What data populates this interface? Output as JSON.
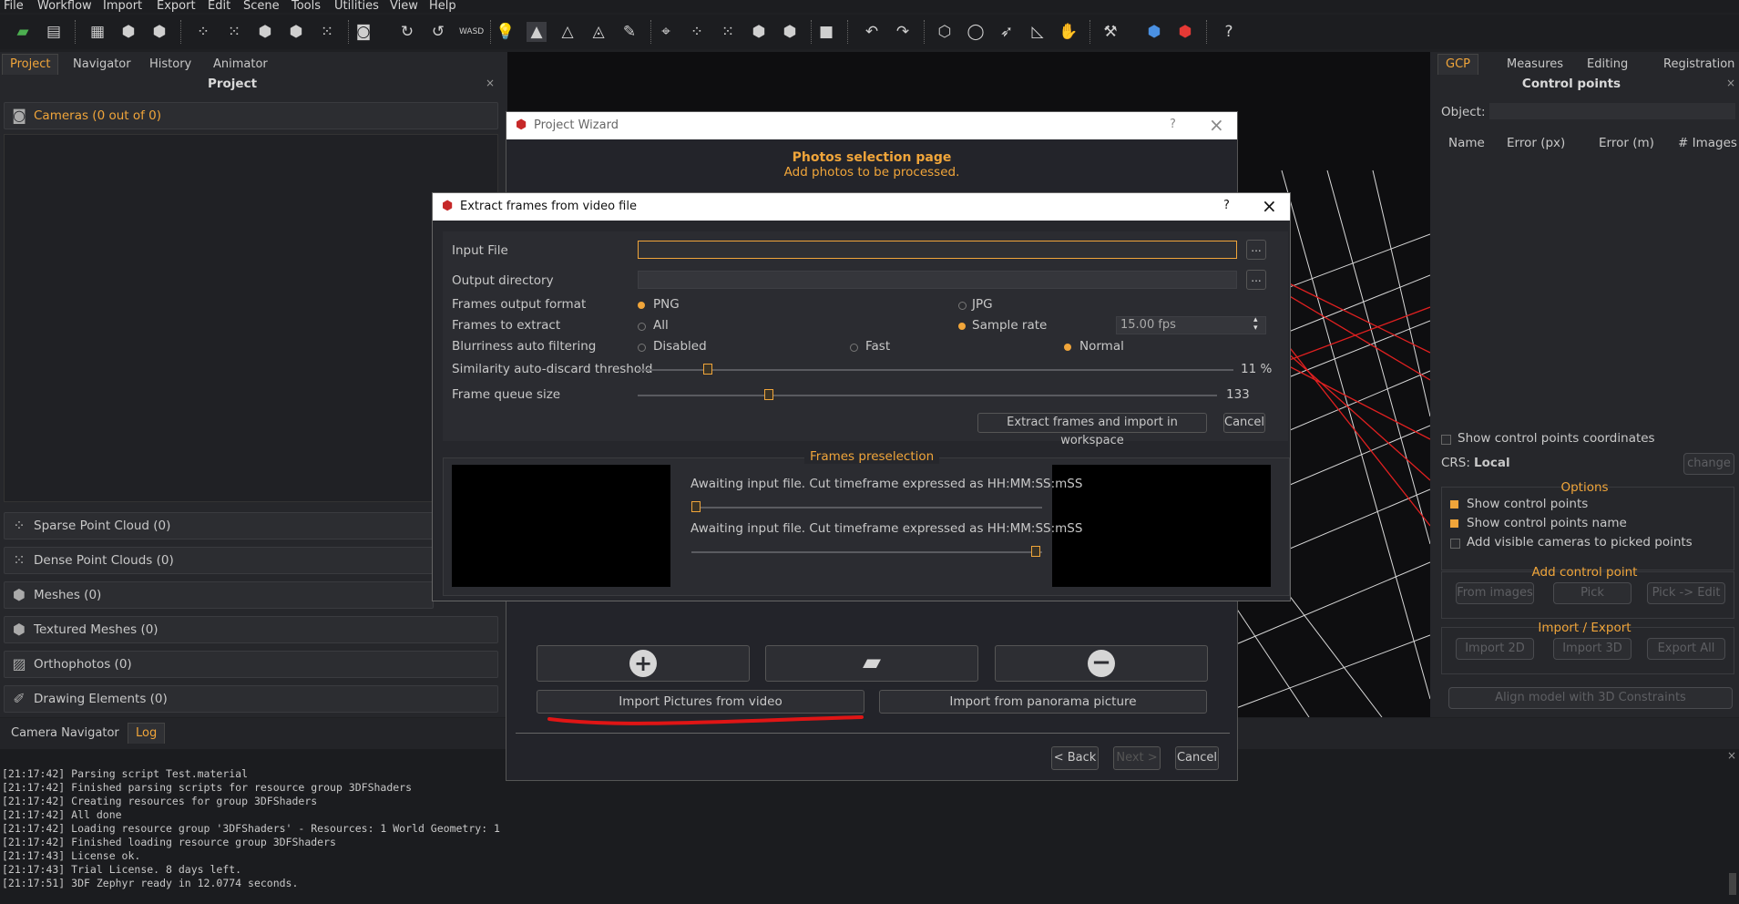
{
  "menubar": [
    "File",
    "Workflow",
    "Import",
    "Export",
    "Edit",
    "Scene",
    "Tools",
    "Utilities",
    "View",
    "Help"
  ],
  "toolbar_icons": [
    "folder-icon",
    "save-icon",
    "grid-icon",
    "cube-icon",
    "cube-icon",
    "points-icon",
    "points-icon",
    "cube-icon",
    "cube-icon",
    "points-icon",
    "camera-icon",
    "rotate-icon",
    "rotate-icon",
    "wasd-icon",
    "bulb-icon",
    "triangle-icon",
    "triangle-icon",
    "triangle-icon",
    "brush-icon",
    "measure-icon",
    "points-icon",
    "points-icon",
    "cube-icon",
    "cube-icon",
    "square-icon",
    "undo-icon",
    "redo-icon",
    "shape-icon",
    "circle-icon",
    "arrow-icon",
    "ruler-icon",
    "hand-icon",
    "tool-icon",
    "cube-blue-icon",
    "cube-red-icon",
    "help-icon"
  ],
  "left": {
    "tabs": [
      "Project",
      "Navigator",
      "History",
      "Animator"
    ],
    "title": "Project",
    "cameras": "Cameras (0 out of 0)",
    "sections": [
      "Sparse Point Cloud (0)",
      "Dense Point Clouds (0)",
      "Meshes (0)",
      "Textured Meshes (0)",
      "Orthophotos (0)",
      "Drawing Elements (0)"
    ]
  },
  "right": {
    "tabs": [
      "GCP",
      "Measures",
      "Editing",
      "Registration"
    ],
    "title": "Control points",
    "object_label": "Object:",
    "columns": [
      "Name",
      "Error (px)",
      "Error (m)",
      "# Images"
    ],
    "show_coords": "Show control points coordinates",
    "crs_label": "CRS:",
    "crs_value": "Local",
    "change": "change",
    "options_title": "Options",
    "options": [
      "Show control points",
      "Show control points name",
      "Add visible cameras to picked points"
    ],
    "add_title": "Add control point",
    "add_buttons": [
      "From images",
      "Pick",
      "Pick -> Edit"
    ],
    "io_title": "Import / Export",
    "io_buttons": [
      "Import 2D",
      "Import 3D",
      "Export All"
    ],
    "align": "Align model with 3D Constraints"
  },
  "bottom": {
    "tabs": [
      "Camera Navigator",
      "Log"
    ],
    "log": [
      "[21:17:42] Parsing script Test.material",
      "[21:17:42] Finished parsing scripts for resource group 3DFShaders",
      "[21:17:42] Creating resources for group 3DFShaders",
      "[21:17:42] All done",
      "[21:17:42] Loading resource group '3DFShaders' - Resources: 1 World Geometry: 1",
      "[21:17:42] Finished loading resource group 3DFShaders",
      "[21:17:43] License ok.",
      "[21:17:43] Trial License. 8 days left.",
      "[21:17:51] 3DF Zephyr ready in 12.0774 seconds."
    ]
  },
  "wizard": {
    "title": "Project Wizard",
    "help": "?",
    "page_title": "Photos selection page",
    "page_subtitle": "Add photos to be processed.",
    "import_video": "Import Pictures from video",
    "import_panorama": "Import from panorama picture",
    "back": "< Back",
    "next": "Next >",
    "cancel": "Cancel"
  },
  "extract": {
    "title": "Extract frames from video file",
    "help": "?",
    "input_file_label": "Input File",
    "input_file_value": "",
    "output_dir_label": "Output directory",
    "output_dir_value": "",
    "browse": "...",
    "format_label": "Frames output format",
    "format_png": "PNG",
    "format_jpg": "JPG",
    "frames_label": "Frames to extract",
    "frames_all": "All",
    "frames_sample": "Sample rate",
    "fps": "15.00 fps",
    "blur_label": "Blurriness auto filtering",
    "blur_disabled": "Disabled",
    "blur_fast": "Fast",
    "blur_normal": "Normal",
    "similarity_label": "Similarity auto-discard threshold",
    "similarity_value": "11 %",
    "similarity_fraction": 0.11,
    "queue_label": "Frame queue size",
    "queue_value": "133",
    "extract_button": "Extract frames and import in workspace",
    "cancel": "Cancel",
    "preselection_title": "Frames preselection",
    "awaiting_1": "Awaiting input file. Cut timeframe expressed as HH:MM:SS:mSS",
    "awaiting_2": "Awaiting input file. Cut timeframe expressed as HH:MM:SS:mSS"
  }
}
